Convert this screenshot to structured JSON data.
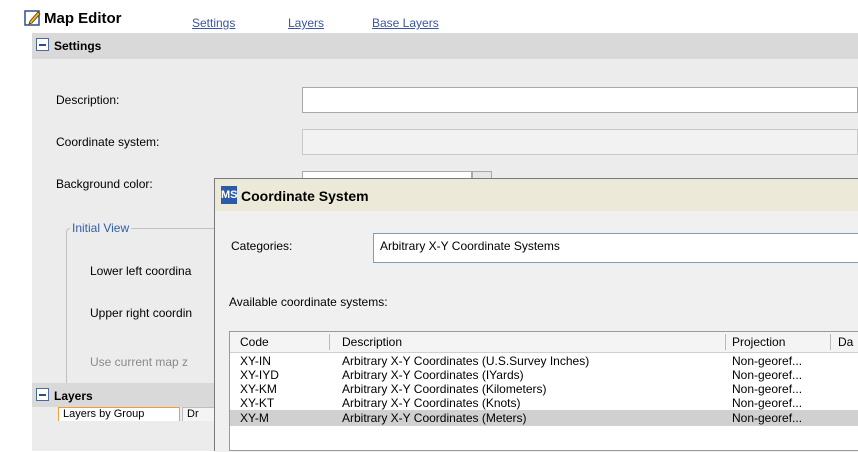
{
  "header": {
    "title": "Map Editor",
    "tabs": [
      "Settings",
      "Layers",
      "Base Layers"
    ],
    "icon": "edit-pencil-icon"
  },
  "settings": {
    "title": "Settings",
    "description_label": "Description:",
    "coordinate_system_label": "Coordinate system:",
    "background_color_label": "Background color:",
    "initial_view_label": "Initial View",
    "lower_left_label": "Lower left coordina",
    "upper_right_label": "Upper right coordin",
    "use_current_label": "Use current map z"
  },
  "layers": {
    "title": "Layers",
    "tabs": [
      "Layers by Group",
      "Dr"
    ]
  },
  "dialog": {
    "title": "Coordinate System",
    "icon_text": "MS",
    "categories_label": "Categories:",
    "category_value": "Arbitrary X-Y Coordinate Systems",
    "available_label": "Available coordinate systems:",
    "columns": [
      "Code",
      "Description",
      "Projection",
      "Da"
    ],
    "rows": [
      {
        "code": "XY-IN",
        "description": "Arbitrary X-Y Coordinates (U.S.Survey Inches)",
        "projection": "Non-georef..."
      },
      {
        "code": "XY-IYD",
        "description": "Arbitrary X-Y Coordinates (IYards)",
        "projection": "Non-georef..."
      },
      {
        "code": "XY-KM",
        "description": "Arbitrary X-Y Coordinates (Kilometers)",
        "projection": "Non-georef..."
      },
      {
        "code": "XY-KT",
        "description": "Arbitrary X-Y Coordinates (Knots)",
        "projection": "Non-georef..."
      },
      {
        "code": "XY-M",
        "description": "Arbitrary X-Y Coordinates (Meters)",
        "projection": "Non-georef..."
      }
    ],
    "selected_code": "XY-M"
  }
}
